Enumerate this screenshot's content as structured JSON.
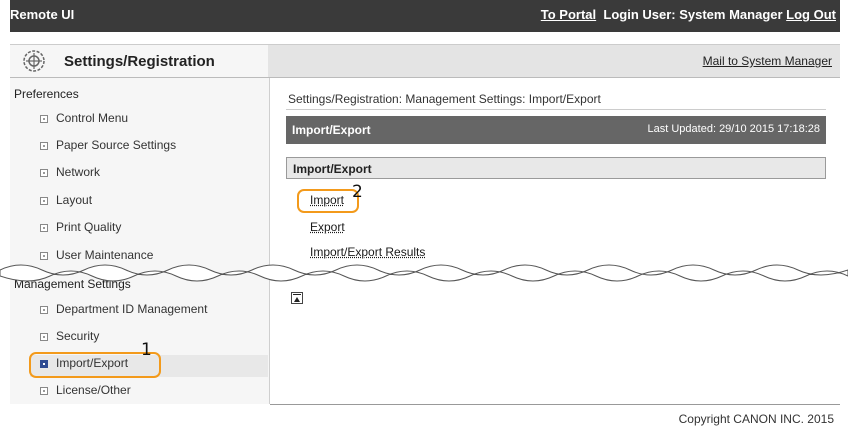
{
  "topbar": {
    "app_name": "Remote UI",
    "portal_link": "To Portal",
    "login_label": "Login User: System Manager",
    "logout_link": "Log Out"
  },
  "titlebar": {
    "title": "Settings/Registration",
    "mail_link": "Mail to System Manager",
    "icon": "settings-gear-icon"
  },
  "sidebar": {
    "preferences_title": "Preferences",
    "preferences_items": [
      {
        "label": "Control Menu"
      },
      {
        "label": "Paper Source Settings"
      },
      {
        "label": "Network"
      },
      {
        "label": "Layout"
      },
      {
        "label": "Print Quality"
      },
      {
        "label": "User Maintenance"
      }
    ],
    "management_title": "Management Settings",
    "management_items": [
      {
        "label": "Department ID Management"
      },
      {
        "label": "Security"
      },
      {
        "label": "Import/Export"
      },
      {
        "label": "License/Other"
      }
    ]
  },
  "main": {
    "breadcrumb": "Settings/Registration: Management Settings: Import/Export",
    "header_title": "Import/Export",
    "last_updated": "Last Updated: 29/10 2015 17:18:28",
    "section_title": "Import/Export",
    "links": [
      {
        "label": "Import"
      },
      {
        "label": "Export"
      },
      {
        "label": "Import/Export Results"
      }
    ]
  },
  "annotations": {
    "marker_1": "1",
    "marker_2": "2"
  },
  "footer": {
    "copyright": "Copyright CANON INC. 2015"
  },
  "colors": {
    "accent_highlight": "#f39a1b",
    "header_bar": "#666666",
    "top_bar": "#3a3a3a"
  }
}
